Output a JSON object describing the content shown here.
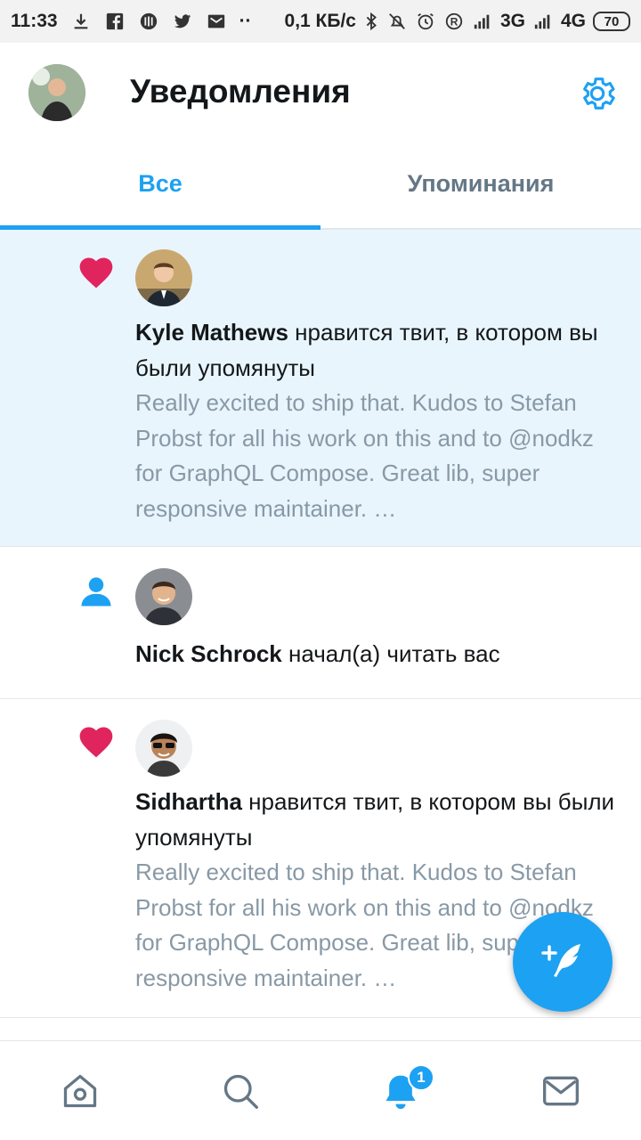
{
  "status_bar": {
    "time": "11:33",
    "speed": "0,1 КБ/с",
    "net1": "3G",
    "net2": "4G",
    "battery": "70",
    "icons": [
      "download-icon",
      "facebook-icon",
      "app-icon",
      "twitter-icon",
      "mail-icon",
      "more-dots-icon",
      "bluetooth-icon",
      "mute-icon",
      "alarm-icon",
      "registered-icon",
      "signal-icon",
      "signal-icon"
    ]
  },
  "header": {
    "title": "Уведомления",
    "settings_icon": "gear-icon"
  },
  "tabs": [
    {
      "label": "Все",
      "active": true
    },
    {
      "label": "Упоминания",
      "active": false
    }
  ],
  "notifications": [
    {
      "type": "like",
      "icon": "heart-icon",
      "user": "Kyle Mathews",
      "action": " нравится твит, в котором вы были упомянуты",
      "tweet": "Really excited to ship that. Kudos to Stefan Probst for all his work on this and to @nodkz for GraphQL Compose. Great lib, super responsive maintainer. …",
      "unread": true
    },
    {
      "type": "follow",
      "icon": "person-icon",
      "user": "Nick Schrock",
      "action": " начал(а) читать вас",
      "unread": false
    },
    {
      "type": "like",
      "icon": "heart-icon",
      "user": "Sidhartha",
      "action": " нравится твит, в котором вы были упомянуты",
      "tweet": "Really excited to ship that. Kudos to Stefan Probst for all his work on this and to @nodkz for GraphQL Compose. Great lib, super responsive maintainer. …",
      "unread": false
    }
  ],
  "bottom_nav": {
    "items": [
      "home-icon",
      "search-icon",
      "bell-icon",
      "mail-icon"
    ],
    "notification_badge": "1"
  },
  "fab": {
    "icon": "compose-tweet-icon"
  },
  "colors": {
    "accent": "#1da1f2",
    "like": "#e0245e",
    "unread_bg": "#e8f5fd",
    "secondary_text": "#8899a6"
  }
}
